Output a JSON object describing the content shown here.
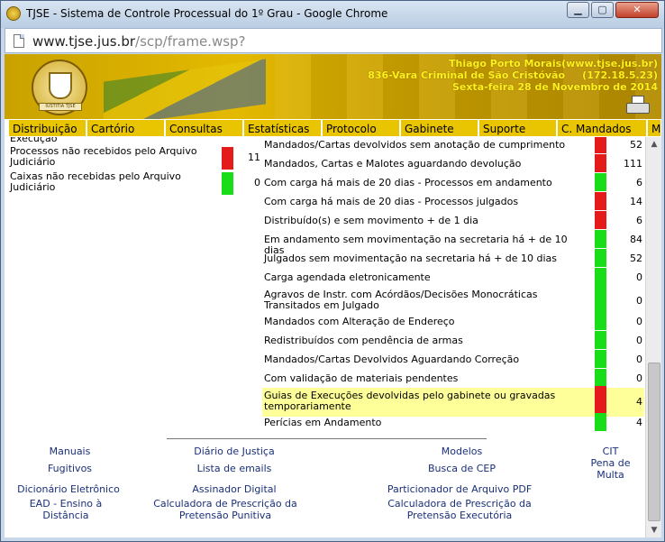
{
  "window": {
    "title": "TJSE - Sistema de Controle Processual do 1º Grau - Google Chrome",
    "minimize": "▁",
    "maximize": "▢",
    "close": "✕"
  },
  "address": {
    "host": "www.tjse.jus.br",
    "path": "/scp/frame.wsp?"
  },
  "header": {
    "user_line": "Thiago Porto Morais(www.tjse.jus.br)",
    "court_line": "836-Vara Criminal de São Cristóvão     (172.18.5.23)",
    "date_line": "Sexta-feira 28 de Novembro de 2014",
    "seal_text": "IUSTITIA TJSE"
  },
  "menu": [
    "Distribuição",
    "Cartório",
    "Consultas",
    "Estatísticas",
    "Protocolo",
    "Gabinete",
    "Suporte",
    "C. Mandados",
    "M"
  ],
  "left_items": [
    {
      "label": "Execução",
      "value": "",
      "status": ""
    },
    {
      "label": "Processos não recebidos pelo Arquivo Judiciário",
      "value": "11",
      "status": "red"
    },
    {
      "label": "Caixas não recebidas pelo Arquivo Judiciário",
      "value": "0",
      "status": "green"
    }
  ],
  "right_items": [
    {
      "label": "Mandados/Cartas devolvidos sem anotação de cumprimento",
      "value": "52",
      "status": "red",
      "highlight": false
    },
    {
      "label": "Mandados, Cartas e Malotes aguardando devolução",
      "value": "111",
      "status": "red",
      "highlight": false
    },
    {
      "label": "Com carga há mais de 20 dias - Processos em andamento",
      "value": "6",
      "status": "green",
      "highlight": false
    },
    {
      "label": "Com carga há mais de 20 dias - Processos julgados",
      "value": "14",
      "status": "red",
      "highlight": false
    },
    {
      "label": "Distribuído(s) e sem movimento + de 1 dia",
      "value": "6",
      "status": "red",
      "highlight": false
    },
    {
      "label": "Em andamento sem movimentação na secretaria há + de 10 dias",
      "value": "84",
      "status": "green",
      "highlight": false
    },
    {
      "label": "Julgados sem movimentação na secretaria há + de 10 dias",
      "value": "52",
      "status": "green",
      "highlight": false
    },
    {
      "label": "Carga agendada eletronicamente",
      "value": "0",
      "status": "green",
      "highlight": false
    },
    {
      "label": "Agravos de Instr. com Acórdãos/Decisões Monocráticas Transitados em Julgado",
      "value": "0",
      "status": "green",
      "highlight": false
    },
    {
      "label": "Mandados com Alteração de Endereço",
      "value": "0",
      "status": "green",
      "highlight": false
    },
    {
      "label": "Redistribuídos com pendência de armas",
      "value": "0",
      "status": "green",
      "highlight": false
    },
    {
      "label": "Mandados/Cartas Devolvidos Aguardando Correção",
      "value": "0",
      "status": "green",
      "highlight": false
    },
    {
      "label": "Com validação de materiais pendentes",
      "value": "0",
      "status": "green",
      "highlight": false
    },
    {
      "label": "Guias de Execuções devolvidas pelo gabinete ou gravadas temporariamente",
      "value": "4",
      "status": "red",
      "highlight": true
    },
    {
      "label": "Perícias em Andamento",
      "value": "4",
      "status": "green",
      "highlight": false
    }
  ],
  "footer_links": [
    "Manuais",
    "Diário de Justiça",
    "Modelos",
    "CIT",
    "Fugitivos",
    "Lista de emails",
    "Busca de CEP",
    "Pena de Multa",
    "Dicionário Eletrônico",
    "Assinador Digital",
    "Particionador de Arquivo PDF",
    "EAD - Ensino à Distância",
    "Calculadora de Prescrição da Pretensão Punitiva",
    "Calculadora de Prescrição da Pretensão Executória"
  ],
  "colors": {
    "accent": "#e9c400",
    "red_status": "#e51b1b",
    "green_status": "#18dd18",
    "highlight": "#ffff99",
    "link": "#1a2f7a"
  }
}
